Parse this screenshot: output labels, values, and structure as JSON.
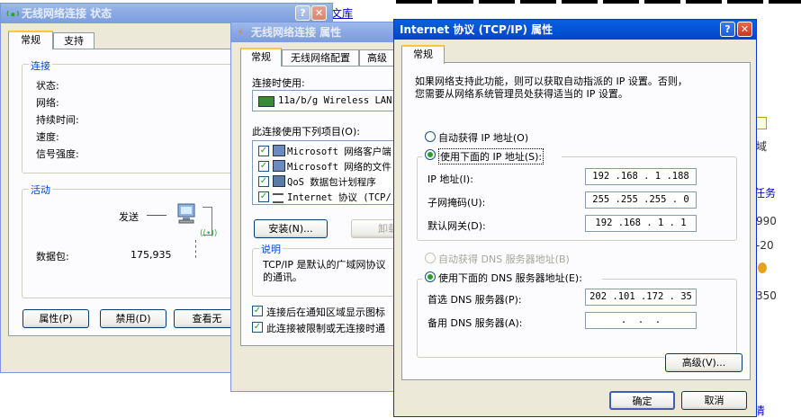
{
  "background": {
    "doc_link": "文库",
    "right_fragments": [
      "域",
      "任务",
      "990",
      "-20",
      "350",
      "清"
    ]
  },
  "status_window": {
    "title": "无线网络连接 状态",
    "tabs": [
      "常规",
      "支持"
    ],
    "connection_group": "连接",
    "labels": [
      "状态:",
      "网络:",
      "持续时间:",
      "速度:",
      "信号强度:"
    ],
    "activity_group": "活动",
    "sent_label": "发送",
    "packets_label": "数据包:",
    "packets_value": "175,935",
    "buttons": [
      "属性(P)",
      "禁用(D)",
      "查看无"
    ]
  },
  "props_window": {
    "title": "无线网络连接 属性",
    "tabs": [
      "常规",
      "无线网络配置",
      "高级"
    ],
    "connect_using_label": "连接时使用:",
    "adapter": "11a/b/g Wireless LAN",
    "items_label": "此连接使用下列项目(O):",
    "items": [
      "Microsoft 网络客户端",
      "Microsoft 网络的文件",
      "QoS 数据包计划程序",
      "Internet 协议 (TCP/"
    ],
    "install_button": "安装(N)...",
    "uninstall_button": "卸载",
    "description_group": "说明",
    "description": [
      "TCP/IP 是默认的广域网协议",
      "的通讯。"
    ],
    "check1": "连接后在通知区域显示图标",
    "check2": "此连接被限制或无连接时通"
  },
  "tcpip_window": {
    "title": "Internet 协议 (TCP/IP) 属性",
    "tab": "常规",
    "intro": [
      "如果网络支持此功能，则可以获取自动指派的 IP 设置。否则，",
      "您需要从网络系统管理员处获得适当的 IP 设置。"
    ],
    "auto_ip": "自动获得 IP 地址(O)",
    "manual_ip": "使用下面的 IP 地址(S):",
    "ip_label": "IP 地址(I):",
    "ip_value": "192 .168 . 1 .188",
    "mask_label": "子网掩码(U):",
    "mask_value": "255 .255 .255 . 0",
    "gateway_label": "默认网关(D):",
    "gateway_value": "192 .168 . 1 . 1",
    "auto_dns": "自动获得 DNS 服务器地址(B)",
    "manual_dns": "使用下面的 DNS 服务器地址(E):",
    "dns1_label": "首选 DNS 服务器(P):",
    "dns1_value": "202 .101 .172 . 35",
    "dns2_label": "备用 DNS 服务器(A):",
    "dns2_value": " .  .  . ",
    "advanced_button": "高级(V)...",
    "ok_button": "确定",
    "cancel_button": "取消"
  }
}
